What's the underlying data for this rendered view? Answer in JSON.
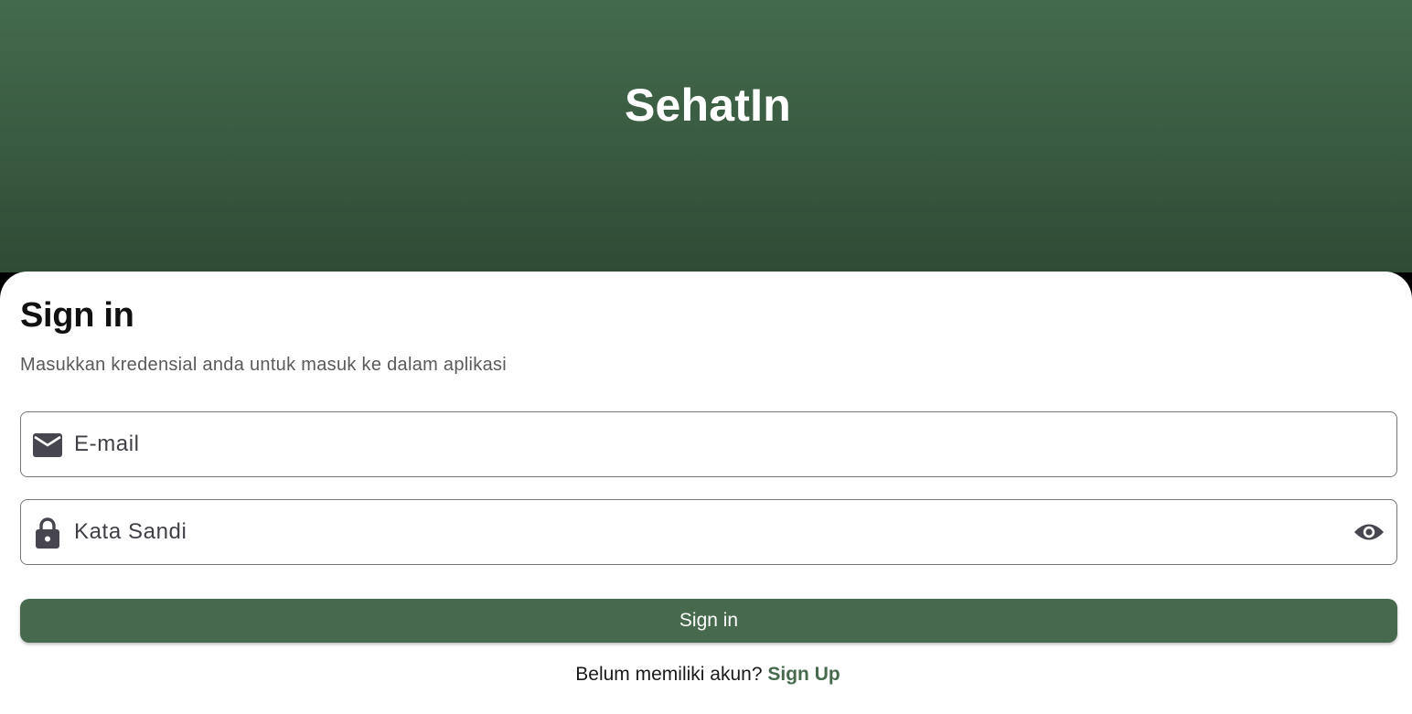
{
  "header": {
    "app_title": "SehatIn"
  },
  "card": {
    "title": "Sign in",
    "subtitle": "Masukkan kredensial anda untuk masuk ke dalam aplikasi"
  },
  "form": {
    "email": {
      "placeholder": "E-mail",
      "value": "",
      "icon": "mail-icon"
    },
    "password": {
      "placeholder": "Kata Sandi",
      "value": "",
      "icon": "lock-icon",
      "toggle_icon": "eye-icon"
    },
    "submit_label": "Sign in"
  },
  "footer": {
    "prompt_text": "Belum memiliki akun?",
    "signup_label": "Sign Up"
  },
  "colors": {
    "header_top": "#446a4d",
    "header_bottom": "#2f4a35",
    "accent": "#476a4e",
    "card_background": "#ffffff"
  }
}
